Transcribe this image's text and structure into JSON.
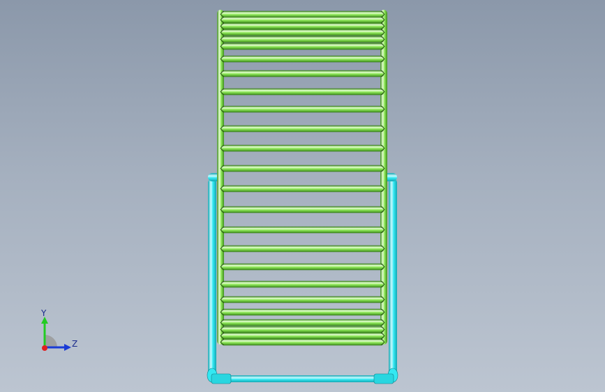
{
  "model": {
    "frame_color": "#33e8f2",
    "frame_dark": "#14a7b3",
    "frame_light": "#c9fbff",
    "slat_color": "#8fe85a",
    "slat_dark": "#3f8f1e",
    "slat_light": "#e6ffd4"
  },
  "triad": {
    "y_label": "Y",
    "z_label": "Z",
    "y_color": "#22cc22",
    "z_color": "#1a3bd6",
    "x_color": "#e02020",
    "icons": [
      "y-axis-arrow-icon",
      "z-axis-arrow-icon",
      "x-axis-dot-icon"
    ]
  }
}
